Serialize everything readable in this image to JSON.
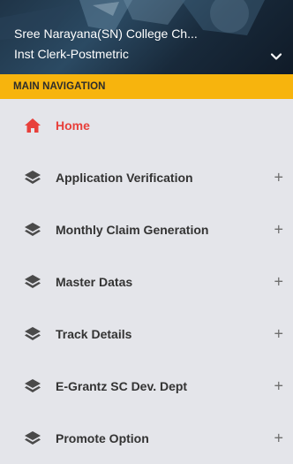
{
  "user": {
    "organization": "Sree Narayana(SN) College Ch...",
    "role": "Inst Clerk-Postmetric"
  },
  "nav": {
    "header": "MAIN NAVIGATION",
    "items": [
      {
        "label": "Home",
        "icon": "home-icon",
        "active": true,
        "expandable": false
      },
      {
        "label": "Application Verification",
        "icon": "layers-icon",
        "active": false,
        "expandable": true
      },
      {
        "label": "Monthly Claim Generation",
        "icon": "layers-icon",
        "active": false,
        "expandable": true
      },
      {
        "label": "Master Datas",
        "icon": "layers-icon",
        "active": false,
        "expandable": true
      },
      {
        "label": "Track Details",
        "icon": "layers-icon",
        "active": false,
        "expandable": true
      },
      {
        "label": "E-Grantz SC Dev. Dept",
        "icon": "layers-icon",
        "active": false,
        "expandable": true
      },
      {
        "label": "Promote Option",
        "icon": "layers-icon",
        "active": false,
        "expandable": true
      }
    ],
    "expand_symbol": "+"
  },
  "colors": {
    "header_bg": "#f7b40d",
    "active": "#e8403b",
    "sidebar_bg": "#e4e5ea"
  }
}
